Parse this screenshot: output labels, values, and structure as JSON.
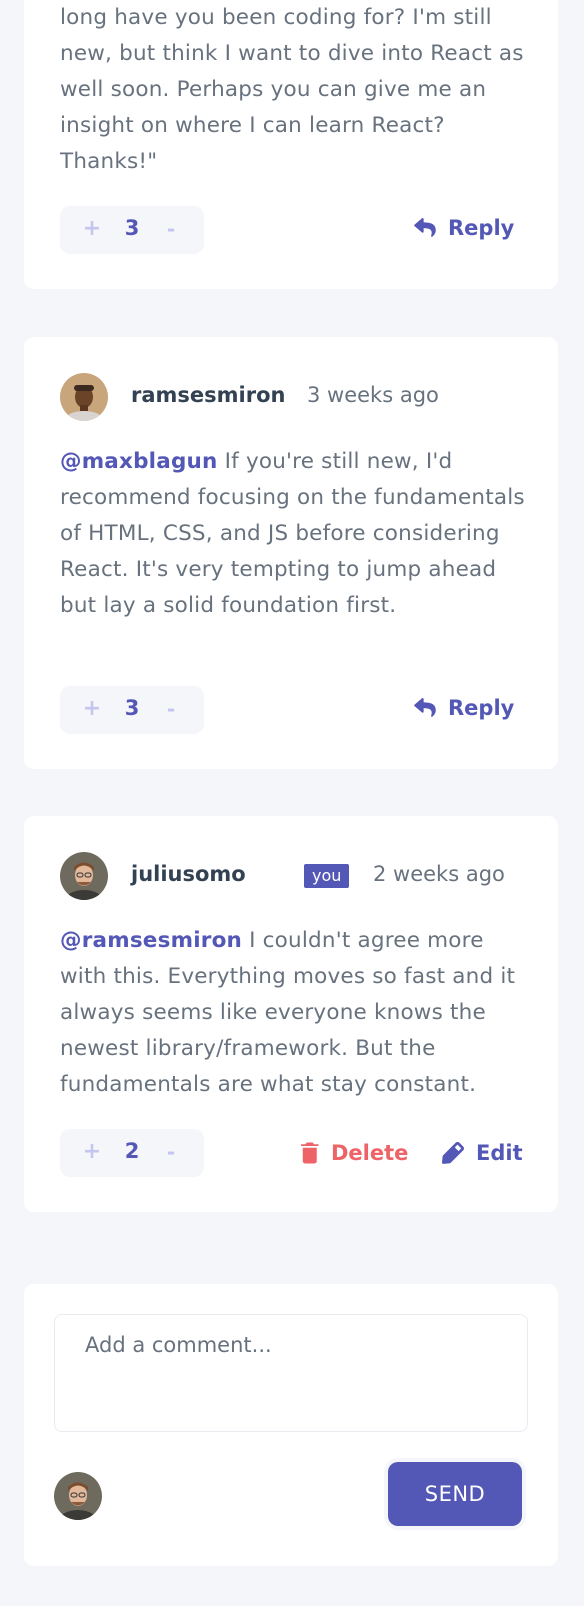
{
  "comments": [
    {
      "body": "long have you been coding for? I'm still new, but think I want to dive into React as well soon. Perhaps you can give me an insight on where I can learn React? Thanks!\"",
      "score": "3",
      "action_label": "Reply"
    },
    {
      "username": "ramsesmiron",
      "timestamp": "3 weeks ago",
      "mention": "@maxblagun",
      "body": " If you're still new, I'd recommend focusing on the fundamentals of HTML, CSS, and JS before considering React. It's very tempting to jump ahead but lay a solid foundation first.",
      "score": "3",
      "action_label": "Reply"
    },
    {
      "username": "juliusomo",
      "badge": "you",
      "timestamp": "2 weeks ago",
      "mention": "@ramsesmiron",
      "body": " I couldn't agree more with this. Everything moves so fast and it always seems like everyone knows the newest library/framework. But the fundamentals are what stay constant.",
      "score": "2",
      "delete_label": "Delete",
      "edit_label": "Edit"
    }
  ],
  "vote": {
    "plus": "+",
    "minus": "-"
  },
  "add_comment": {
    "placeholder": "Add a comment...",
    "send_label": "SEND"
  },
  "icons": {
    "reply": "reply-icon",
    "delete": "trash-icon",
    "edit": "pencil-icon"
  },
  "colors": {
    "primary": "#5357b6",
    "vote_light": "#c5c6ef",
    "danger": "#ed6368",
    "text": "#67727e",
    "name": "#334253",
    "background": "#f5f6fa"
  }
}
